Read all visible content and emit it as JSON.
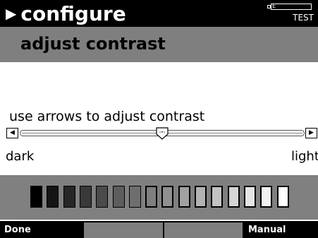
{
  "header": {
    "title": "configure",
    "battery_label": "E",
    "battery_label_right": "F",
    "battery_level": 0.0,
    "mode": "TEST"
  },
  "panel": {
    "title": "adjust contrast",
    "instruction": "use arrows to adjust contrast",
    "slider_value": 0.5,
    "min_label": "dark",
    "max_label": "light"
  },
  "swatches": [
    "#000000",
    "#151515",
    "#272727",
    "#393939",
    "#4b4b4b",
    "#5d5d5d",
    "#6e6e6e",
    "#7f7f7f",
    "#909090",
    "#a1a1a1",
    "#b2b2b2",
    "#c3c3c3",
    "#d4d4d4",
    "#e5e5e5",
    "#f2f2f2",
    "#ffffff"
  ],
  "footer": {
    "done": "Done",
    "manual": "Manual"
  }
}
